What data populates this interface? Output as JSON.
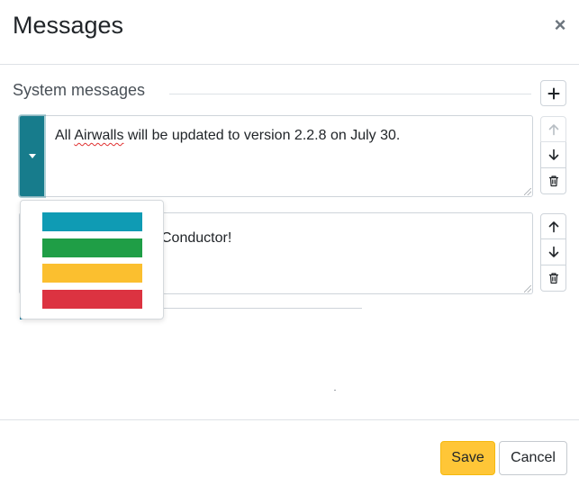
{
  "modal": {
    "title": "Messages",
    "close_symbol": "×"
  },
  "section": {
    "legend": "System messages",
    "add_icon": "plus-icon"
  },
  "messages": [
    {
      "text_prefix": "All ",
      "text_spellcheck": "Airwalls",
      "text_suffix": " will be updated to version 2.2.8 on July 30.",
      "color": "#177c8c",
      "move_up_enabled": false,
      "move_down_enabled": true
    },
    {
      "visible_text": "Conductor!",
      "color": "#177c8c",
      "move_up_enabled": true,
      "move_down_enabled": true
    }
  ],
  "color_menu": {
    "open": true,
    "options": [
      {
        "name": "teal",
        "color": "#0f9bb4"
      },
      {
        "name": "green",
        "color": "#1f9e46"
      },
      {
        "name": "yellow",
        "color": "#fbbf2f"
      },
      {
        "name": "red",
        "color": "#dc3341"
      }
    ]
  },
  "icons": {
    "up": "arrow-up-icon",
    "down": "arrow-down-icon",
    "delete": "trash-icon",
    "dropdown": "caret-down-icon"
  },
  "footer": {
    "save_label": "Save",
    "cancel_label": "Cancel"
  },
  "colors": {
    "accent_save": "#ffc637",
    "row_toggle": "#177c8c"
  }
}
